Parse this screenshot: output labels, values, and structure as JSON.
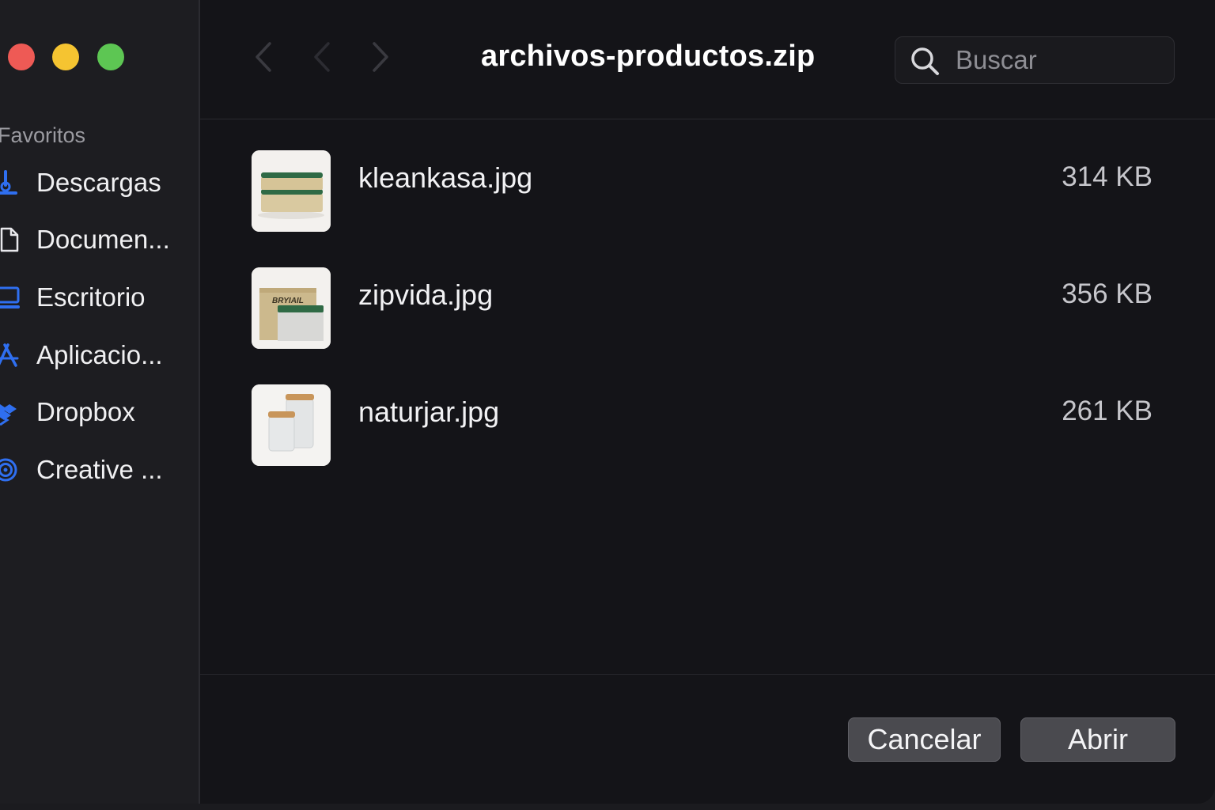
{
  "window": {
    "title": "archivos-productos.zip",
    "controls": [
      "close",
      "minimize",
      "zoom"
    ]
  },
  "sidebar": {
    "heading": "Favoritos",
    "items": [
      {
        "label": "Descargas",
        "icon": "download-icon"
      },
      {
        "label": "Documen...",
        "icon": "document-icon"
      },
      {
        "label": "Escritorio",
        "icon": "desktop-icon"
      },
      {
        "label": "Aplicacio...",
        "icon": "applications-icon"
      },
      {
        "label": "Dropbox",
        "icon": "dropbox-icon"
      },
      {
        "label": "Creative ...",
        "icon": "creative-cloud-icon"
      }
    ]
  },
  "toolbar": {
    "nav": [
      "back-icon",
      "back-disabled-icon",
      "forward-icon"
    ]
  },
  "search": {
    "placeholder": "Buscar",
    "value": ""
  },
  "files": [
    {
      "name": "kleankasa.jpg",
      "size": "314 KB",
      "thumbnail": "sponge-product"
    },
    {
      "name": "zipvida.jpg",
      "size": "356 KB",
      "thumbnail": "box-product",
      "thumbnail_text": "BRYIAIL"
    },
    {
      "name": "naturjar.jpg",
      "size": "261 KB",
      "thumbnail": "glass-jars-product"
    }
  ],
  "footer": {
    "cancel_label": "Cancelar",
    "open_label": "Abrir"
  },
  "colors": {
    "close": "#ee5a55",
    "minimize": "#f5c431",
    "zoom": "#5dc653",
    "sidebar_icon": "#2f6ff0",
    "background": "#141418"
  }
}
